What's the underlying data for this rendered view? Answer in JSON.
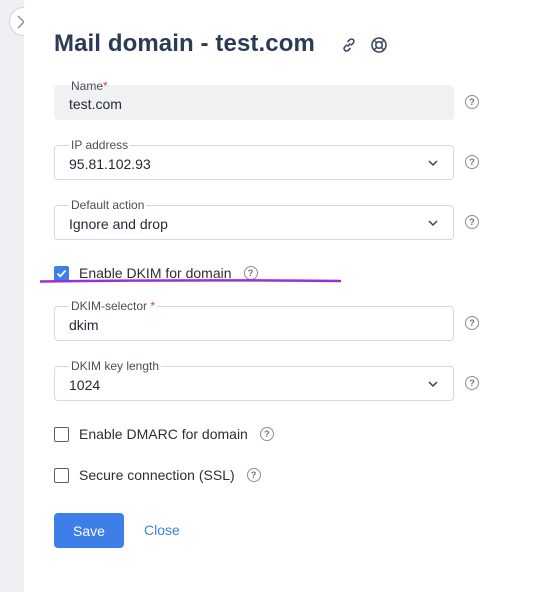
{
  "header": {
    "title": "Mail domain - test.com"
  },
  "icons": {
    "close": "close-icon",
    "link": "link-icon",
    "help_ring": "lifebuoy-icon",
    "help": "help-icon",
    "chevron": "chevron-down-icon"
  },
  "form": {
    "name": {
      "label": "Name",
      "required_mark": "*",
      "value": "test.com"
    },
    "ip_address": {
      "label": "IP address",
      "value": "95.81.102.93"
    },
    "default_action": {
      "label": "Default action",
      "value": "Ignore and drop"
    },
    "enable_dkim": {
      "label": "Enable DKIM for domain",
      "checked": true
    },
    "dkim_selector": {
      "label": "DKIM-selector",
      "required_mark": "*",
      "value": "dkim"
    },
    "dkim_key_length": {
      "label": "DKIM key length",
      "value": "1024"
    },
    "enable_dmarc": {
      "label": "Enable DMARC for domain",
      "checked": false
    },
    "secure_connection": {
      "label": "Secure connection (SSL)",
      "checked": false
    }
  },
  "buttons": {
    "save": "Save",
    "close": "Close"
  },
  "colors": {
    "accent": "#3d7ee8",
    "title": "#2b3a55",
    "highlight": "#9b2fd6"
  }
}
